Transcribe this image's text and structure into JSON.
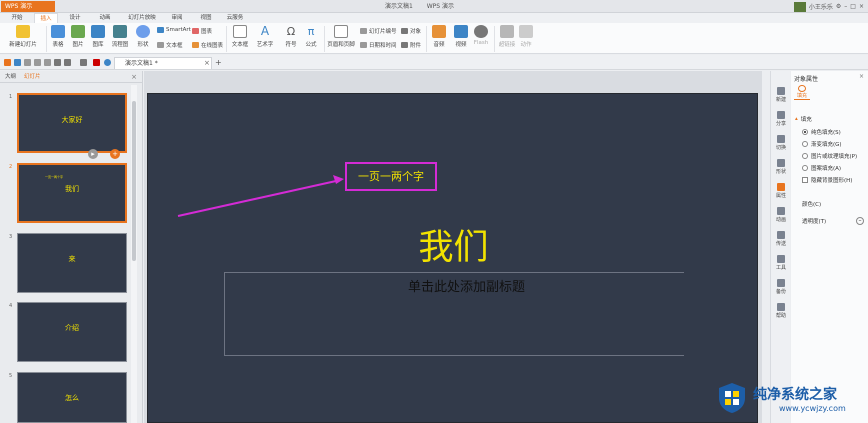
{
  "window": {
    "app_button": "WPS 演示",
    "doc_titles": [
      "演示文稿1",
      "WPS 演示"
    ],
    "user_name": "小王乐乐"
  },
  "menu": {
    "tabs": [
      "开始",
      "插入",
      "设计",
      "动画",
      "幻灯片放映",
      "审阅",
      "视图",
      "云服务"
    ],
    "active": "插入"
  },
  "ribbon": {
    "new_slide": "新建幻灯片",
    "table": "表格",
    "picture": "图片",
    "image_lib": "图库",
    "flowchart": "流程图",
    "shapes": "形状",
    "smartart": "SmartArt",
    "chart": "图表",
    "textbox_icon": "文本框",
    "online_chart": "在线图表",
    "textbox": "文本框",
    "art_text": "艺术字",
    "symbol": "符号",
    "formula": "公式",
    "header_footer": "页眉和页脚",
    "slide_number": "幻灯片编号",
    "date_time": "日期和时间",
    "object": "对象",
    "attachment": "附件",
    "audio": "音频",
    "video": "视频",
    "flash": "Flash",
    "hyperlink": "超链接",
    "action": "动作"
  },
  "doc_tab": {
    "label": "演示文稿1 *",
    "close": "×",
    "new": "+"
  },
  "left_panel": {
    "tabs": [
      "大纲",
      "幻灯片"
    ],
    "active_tab": "幻灯片",
    "close": "×",
    "slides": [
      {
        "num": "1",
        "text": "大家好",
        "small": ""
      },
      {
        "num": "2",
        "text": "我们",
        "small": "一页一两个字"
      },
      {
        "num": "3",
        "text": "来",
        "small": ""
      },
      {
        "num": "4",
        "text": "介绍",
        "small": ""
      },
      {
        "num": "5",
        "text": "怎么",
        "small": ""
      }
    ]
  },
  "slide": {
    "annotated_text": "一页一两个字",
    "title": "我们",
    "subtitle_placeholder": "单击此处添加副标题"
  },
  "right_strip": [
    "新建",
    "分享",
    "切换",
    "形状",
    "属性",
    "动画",
    "传送",
    "工具",
    "备份",
    "帮助"
  ],
  "properties": {
    "title": "对象属性",
    "close": "×",
    "fill_tab": "填充",
    "section": "填充",
    "options": [
      "纯色填充(S)",
      "渐变填充(G)",
      "图片或纹理填充(P)",
      "图案填充(A)",
      "隐藏背景图形(H)"
    ],
    "color_label": "颜色(C)",
    "transparency_label": "透明度(T)"
  },
  "watermark": {
    "title": "纯净系统之家",
    "url": "www.ycwjzy.com"
  },
  "colors": {
    "accent": "#e8741f",
    "slide_bg": "#323a4a",
    "slide_text": "#f2e200",
    "annotation": "#d42bd6"
  }
}
